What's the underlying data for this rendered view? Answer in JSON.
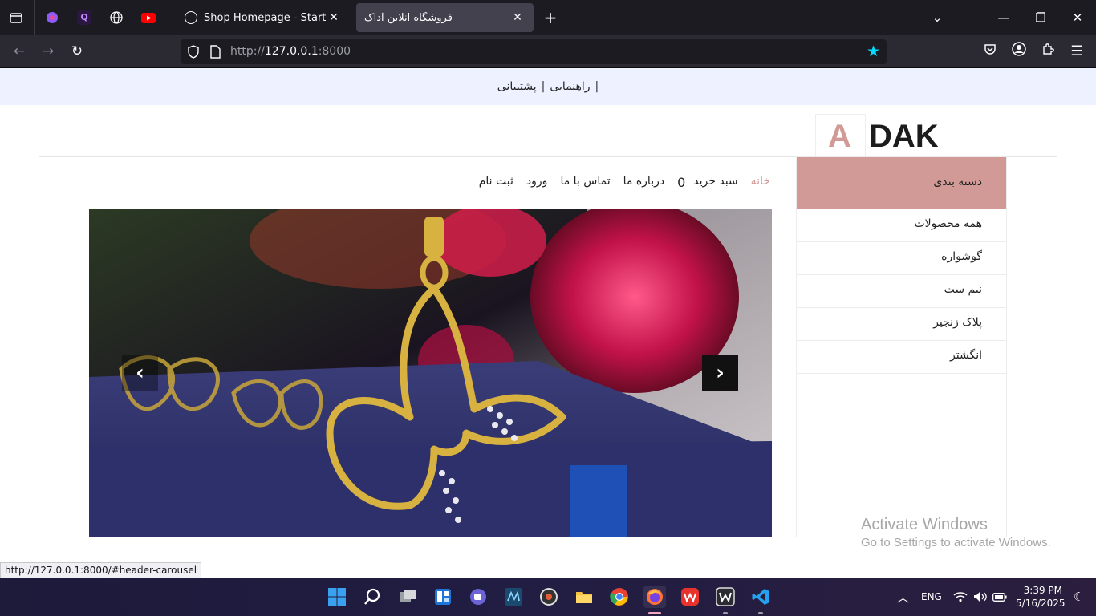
{
  "browser": {
    "tabs": [
      {
        "title": "Shop Homepage - Start Bootstr",
        "active": false
      },
      {
        "title": "فروشگاه انلاین آداک",
        "active": true
      }
    ],
    "url_prefix": "http://",
    "url_host": "127.0.0.1",
    "url_rest": ":8000",
    "status_url": "http://127.0.0.1:8000/#header-carousel"
  },
  "page": {
    "top_links": {
      "help": "راهنمایی",
      "support": "پشتیبانی",
      "pipe": "|"
    },
    "logo": {
      "letter": "A",
      "rest": "DAK"
    },
    "menu": {
      "home": "خانه",
      "cart": "سبد خرید",
      "cart_count": "0",
      "about": "درباره ما",
      "contact": "تماس با ما",
      "login": "ورود",
      "register": "ثبت نام"
    },
    "sidebar": {
      "heading": "دسته بندی",
      "items": [
        "همه محصولات",
        "گوشواره",
        "نیم ست",
        "پلاک زنجیر",
        "انگشتر"
      ]
    },
    "carousel": {
      "prev_label": "‹",
      "next_label": "›"
    }
  },
  "watermark": {
    "line1": "Activate Windows",
    "line2": "Go to Settings to activate Windows."
  },
  "taskbar": {
    "language": "ENG",
    "time": "3:39 PM",
    "date": "5/16/2025"
  },
  "colors": {
    "accent": "#d19a96",
    "top_strip": "#eef1ff",
    "url_star": "#00ddff"
  }
}
